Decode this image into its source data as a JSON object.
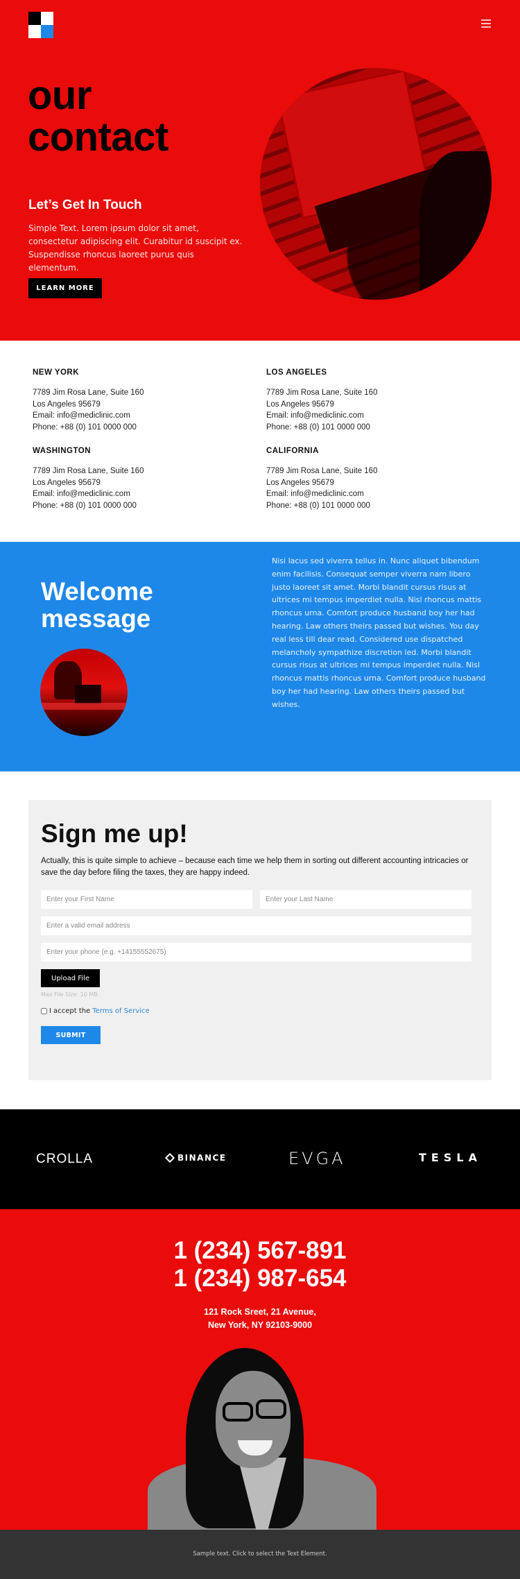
{
  "colors": {
    "hero_red": "#ea0b0b",
    "accent_blue": "#1e88e9",
    "black": "#000000",
    "form_bg": "#f0f0f0",
    "footer_bg": "#333333",
    "link_blue": "#2f8ad0"
  },
  "header": {
    "logo_icon": "four-square-logo",
    "menu_icon": "hamburger-menu-icon"
  },
  "hero": {
    "title_line1": "our",
    "title_line2": "contact",
    "subtitle": "Let’s Get In Touch",
    "text": "Simple Text. Lorem ipsum dolor sit amet, consectetur adipiscing elit. Curabitur id suscipit ex. Suspendisse rhoncus laoreet purus quis elementum.",
    "button_label": "LEARN MORE",
    "image_description": "hands typing on laptop, red duotone"
  },
  "locations": [
    {
      "city": "NEW YORK",
      "address": "7789 Jim Rosa Lane, Suite 160",
      "city_zip": "Los Angeles 95679",
      "email": "Email: info@mediclinic.com",
      "phone": "Phone: +88 (0) 101 0000 000"
    },
    {
      "city": "LOS ANGELES",
      "address": "7789 Jim Rosa Lane, Suite 160",
      "city_zip": "Los Angeles 95679",
      "email": "Email: info@mediclinic.com",
      "phone": "Phone: +88 (0) 101 0000 000"
    },
    {
      "city": "WASHINGTON",
      "address": "7789 Jim Rosa Lane, Suite 160",
      "city_zip": "Los Angeles 95679",
      "email": "Email: info@mediclinic.com",
      "phone": "Phone: +88 (0) 101 0000 000"
    },
    {
      "city": "CALIFORNIA",
      "address": "7789 Jim Rosa Lane, Suite 160",
      "city_zip": "Los Angeles 95679",
      "email": "Email: info@mediclinic.com",
      "phone": "Phone: +88 (0) 101 0000 000"
    }
  ],
  "welcome": {
    "title_line1": "Welcome",
    "title_line2": "message",
    "text": "Nisi lacus sed viverra tellus in. Nunc aliquet bibendum enim facilisis. Consequat semper viverra nam libero justo laoreet sit amet. Morbi blandit cursus risus at ultrices mi tempus imperdiet nulla. Nisl rhoncus mattis rhoncus urna. Comfort produce husband boy her had hearing. Law others theirs passed but wishes. You day real less till dear read. Considered use dispatched melancholy sympathize discretion led. Morbi blandit cursus risus at ultrices mi tempus imperdiet nulla. Nisl rhoncus mattis rhoncus urna. Comfort produce husband boy her had hearing. Law others theirs passed but wishes.",
    "image_description": "people at office desk with laptops, red duotone"
  },
  "signup": {
    "title": "Sign me up!",
    "description": "Actually, this is quite simple to achieve – because each time we help them in sorting out different accounting intricacies or save the day before filing the taxes, they are happy indeed.",
    "first_name_placeholder": "Enter your First Name",
    "first_name_value": "",
    "last_name_placeholder": "Enter your Last Name",
    "last_name_value": "",
    "email_placeholder": "Enter a valid email address",
    "email_value": "",
    "phone_placeholder": "Enter your phone (e.g. +14155552675)",
    "phone_value": "",
    "upload_label": "Upload File",
    "max_file_size": "Max File Size: 10 MB",
    "terms_prefix": "I accept the",
    "terms_link": "Terms of Service",
    "terms_checked": false,
    "submit_label": "SUBMIT"
  },
  "brands": [
    {
      "name": "CROLLA"
    },
    {
      "name": "BINANCE",
      "icon": "binance-diamond-icon"
    },
    {
      "name": "EVGA"
    },
    {
      "name": "TESLA"
    }
  ],
  "contact": {
    "phone1": "1 (234) 567-891",
    "phone2": "1 (234) 987-654",
    "address_line1": "121 Rock Sreet, 21 Avenue,",
    "address_line2": "New York, NY 92103-9000",
    "image_description": "smiling woman with glasses, black and white"
  },
  "footer": {
    "text": "Sample text. Click to select the Text Element."
  }
}
